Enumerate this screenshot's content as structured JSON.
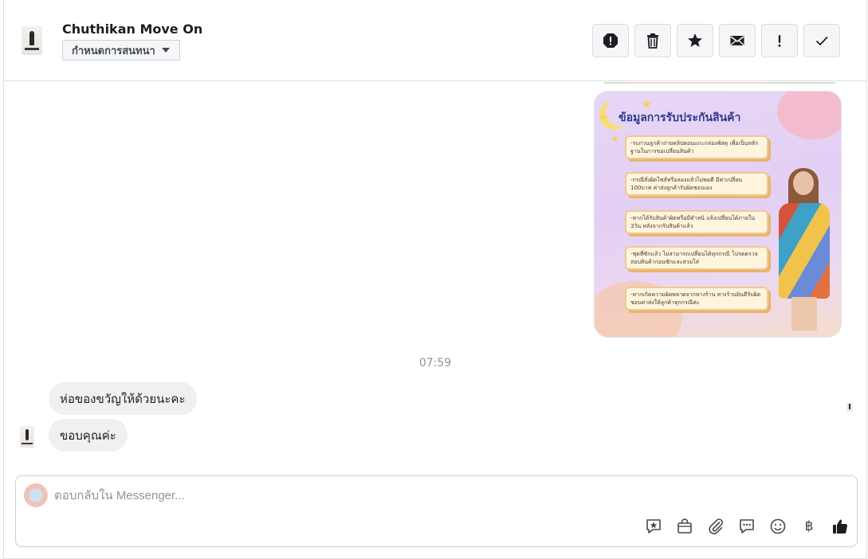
{
  "header": {
    "contact_name": "Chuthikan Move On",
    "assign_label": "กำหนดการสนทนา",
    "tools": [
      {
        "name": "report-spam-icon"
      },
      {
        "name": "delete-icon"
      },
      {
        "name": "star-icon"
      },
      {
        "name": "mark-unread-icon"
      },
      {
        "name": "follow-up-icon"
      },
      {
        "name": "mark-done-icon"
      }
    ]
  },
  "conversation": {
    "promo_image": {
      "title": "ข้อมูลการรับประกันสินค้า",
      "cards": [
        "-รบกวนลูกค้าถ่ายคลิปตอนแกะกล่องพัสดุ เพื่อเป็นหลักฐานในการขอเปลี่ยนสินค้า",
        "-กรณีสั่งผิดไซส์หรือลองแล้วไม่พอดี มีค่าเปลี่ยน 100บาท ค่าส่งลูกค้ารับผิดชอบเอง",
        "-หากได้รับสินค้าผิดหรือมีตำหนิ แจ้งเปลี่ยนได้ภายใน 3วัน หลังจากรับสินค้าแล้ว",
        "-ชุดที่ซักแล้ว ไม่สามารถเปลี่ยนได้ทุกกรณี โปรดตรวจสอบสินค้าก่อนซักและสวมใส่",
        "-หากเกิดความผิดพลาดจากทางร้าน ทางร้านยินดีรับผิดชอบค่าส่งให้ลูกค้าทุกกรณีค่ะ"
      ]
    },
    "timestamp": "07:59",
    "messages": [
      {
        "text": "ห่อของขวัญให้ด้วยนะคะ"
      },
      {
        "text": "ขอบคุณค่ะ"
      }
    ]
  },
  "composer": {
    "placeholder": "ตอบกลับใน Messenger...",
    "tools": [
      {
        "name": "saved-reply-icon"
      },
      {
        "name": "shop-icon"
      },
      {
        "name": "attach-icon"
      },
      {
        "name": "chat-bubble-icon"
      },
      {
        "name": "emoji-icon"
      },
      {
        "name": "baht-icon",
        "glyph": "฿"
      },
      {
        "name": "like-icon"
      }
    ]
  },
  "colors": {
    "accent": "#1877f2",
    "bubble_bg": "#f1f0f0",
    "border": "#dddfe2"
  }
}
